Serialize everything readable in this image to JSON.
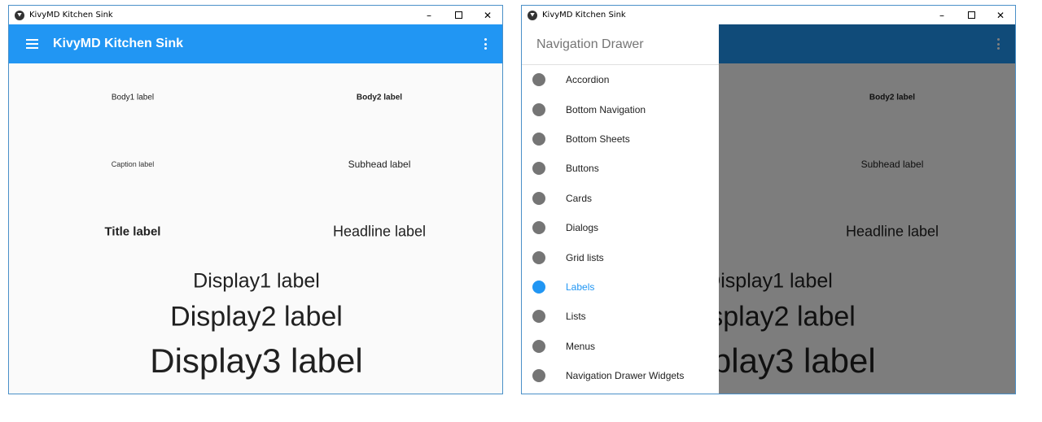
{
  "window": {
    "title": "KivyMD Kitchen Sink",
    "minimize_glyph": "–",
    "close_glyph": "✕"
  },
  "toolbar": {
    "title": "KivyMD Kitchen Sink",
    "color": "#2196f3"
  },
  "labels": {
    "body1": "Body1 label",
    "body2": "Body2 label",
    "caption": "Caption label",
    "subhead": "Subhead label",
    "title": "Title label",
    "headline": "Headline label",
    "display1": "Display1 label",
    "display2": "Display2 label",
    "display3": "Display3 label"
  },
  "drawer": {
    "header": "Navigation Drawer",
    "active_color": "#2196f3",
    "items": [
      {
        "label": "Accordion"
      },
      {
        "label": "Bottom Navigation"
      },
      {
        "label": "Bottom Sheets"
      },
      {
        "label": "Buttons"
      },
      {
        "label": "Cards"
      },
      {
        "label": "Dialogs"
      },
      {
        "label": "Grid lists"
      },
      {
        "label": "Labels",
        "active": true
      },
      {
        "label": "Lists"
      },
      {
        "label": "Menus"
      },
      {
        "label": "Navigation Drawer Widgets"
      }
    ]
  }
}
